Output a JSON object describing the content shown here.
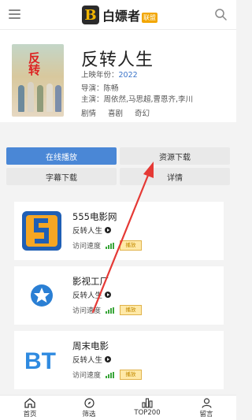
{
  "header": {
    "logo_mark": "B",
    "logo_text": "白嫖者",
    "logo_badge": "联盟"
  },
  "movie": {
    "poster_title": "反转",
    "title": "反转人生",
    "year_label": "上映年份：",
    "year": "2022",
    "director_label": "导演：",
    "director": "陈畅",
    "cast_label": "主演：",
    "cast": "周依然,马思超,曹恩齐,李川",
    "tags": [
      "剧情",
      "喜剧",
      "奇幻"
    ]
  },
  "tabs": [
    "在线播放",
    "资源下载",
    "字幕下载",
    "详情"
  ],
  "sources": [
    {
      "name": "555电影网",
      "subtitle": "反转人生",
      "speed_label": "访问速度",
      "button": "播放"
    },
    {
      "name": "影视工厂",
      "subtitle": "反转人生",
      "speed_label": "访问速度",
      "button": "播放"
    },
    {
      "name": "周末电影",
      "subtitle": "反转人生",
      "speed_label": "访问速度",
      "button": "播放"
    }
  ],
  "bottom_nav": [
    "首页",
    "筛选",
    "TOP200",
    "留言"
  ],
  "colors": {
    "accent": "#4a87d6",
    "year_link": "#3a73c8",
    "annotation_arrow": "#e53935",
    "speed_bars": "#3aa63a"
  }
}
